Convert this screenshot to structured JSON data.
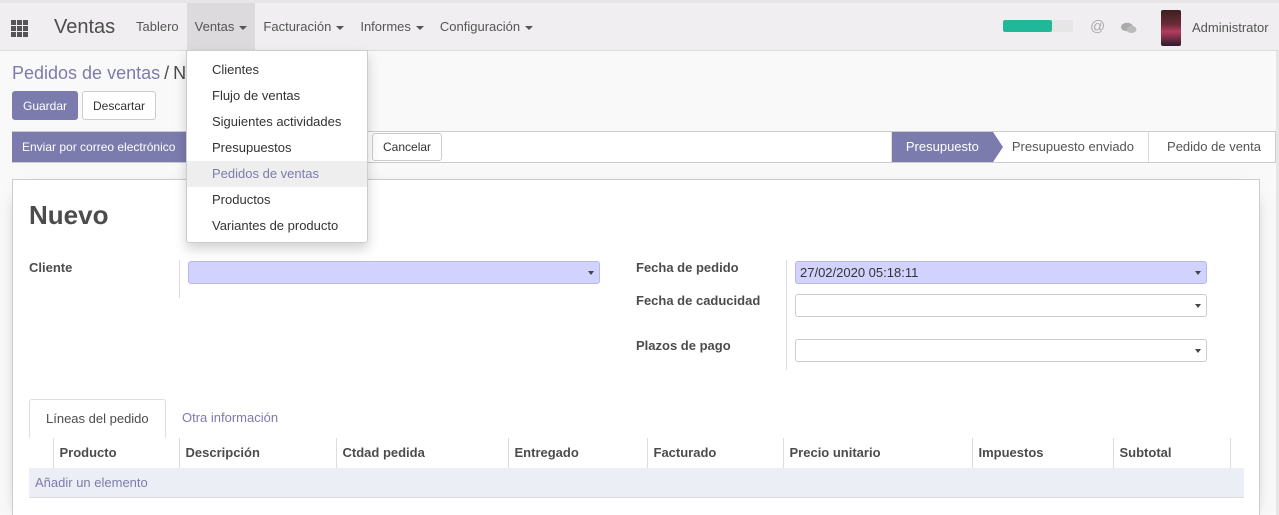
{
  "navbar": {
    "brand": "Ventas",
    "menu": [
      {
        "label": "Tablero",
        "caret": false
      },
      {
        "label": "Ventas",
        "caret": true,
        "open": true
      },
      {
        "label": "Facturación",
        "caret": true
      },
      {
        "label": "Informes",
        "caret": true
      },
      {
        "label": "Configuración",
        "caret": true
      }
    ],
    "progress_fraction": 0.7,
    "progress_color": "#21b799",
    "at_icon": "@",
    "user": "Administrator"
  },
  "dropdown": {
    "items": [
      "Clientes",
      "Flujo de ventas",
      "Siguientes actividades",
      "Presupuestos",
      "Pedidos de ventas",
      "Productos",
      "Variantes de producto"
    ],
    "active_index": 4
  },
  "breadcrumb": {
    "parent": "Pedidos de ventas",
    "separator": "/",
    "current": "N"
  },
  "buttons": {
    "save": "Guardar",
    "discard": "Descartar"
  },
  "statusbar": {
    "email_button": "Enviar por correo electrónico",
    "cancel_button": "Cancelar",
    "stages": [
      "Presupuesto",
      "Presupuesto enviado",
      "Pedido de venta"
    ],
    "active_stage": 0
  },
  "sheet": {
    "title": "Nuevo",
    "labels": {
      "customer": "Cliente",
      "order_date": "Fecha de pedido",
      "expiration_date": "Fecha de caducidad",
      "payment_terms": "Plazos de pago"
    },
    "values": {
      "customer": "",
      "order_date": "27/02/2020 05:18:11",
      "expiration_date": "",
      "payment_terms": ""
    }
  },
  "tabs": {
    "order_lines": "Líneas del pedido",
    "other_info": "Otra información"
  },
  "table": {
    "columns": [
      "Producto",
      "Descripción",
      "Ctdad pedida",
      "Entregado",
      "Facturado",
      "Precio unitario",
      "Impuestos",
      "Subtotal"
    ],
    "add_line": "Añadir un elemento"
  },
  "colors": {
    "accent": "#7c7bad",
    "required_field": "#d2d2ff"
  }
}
